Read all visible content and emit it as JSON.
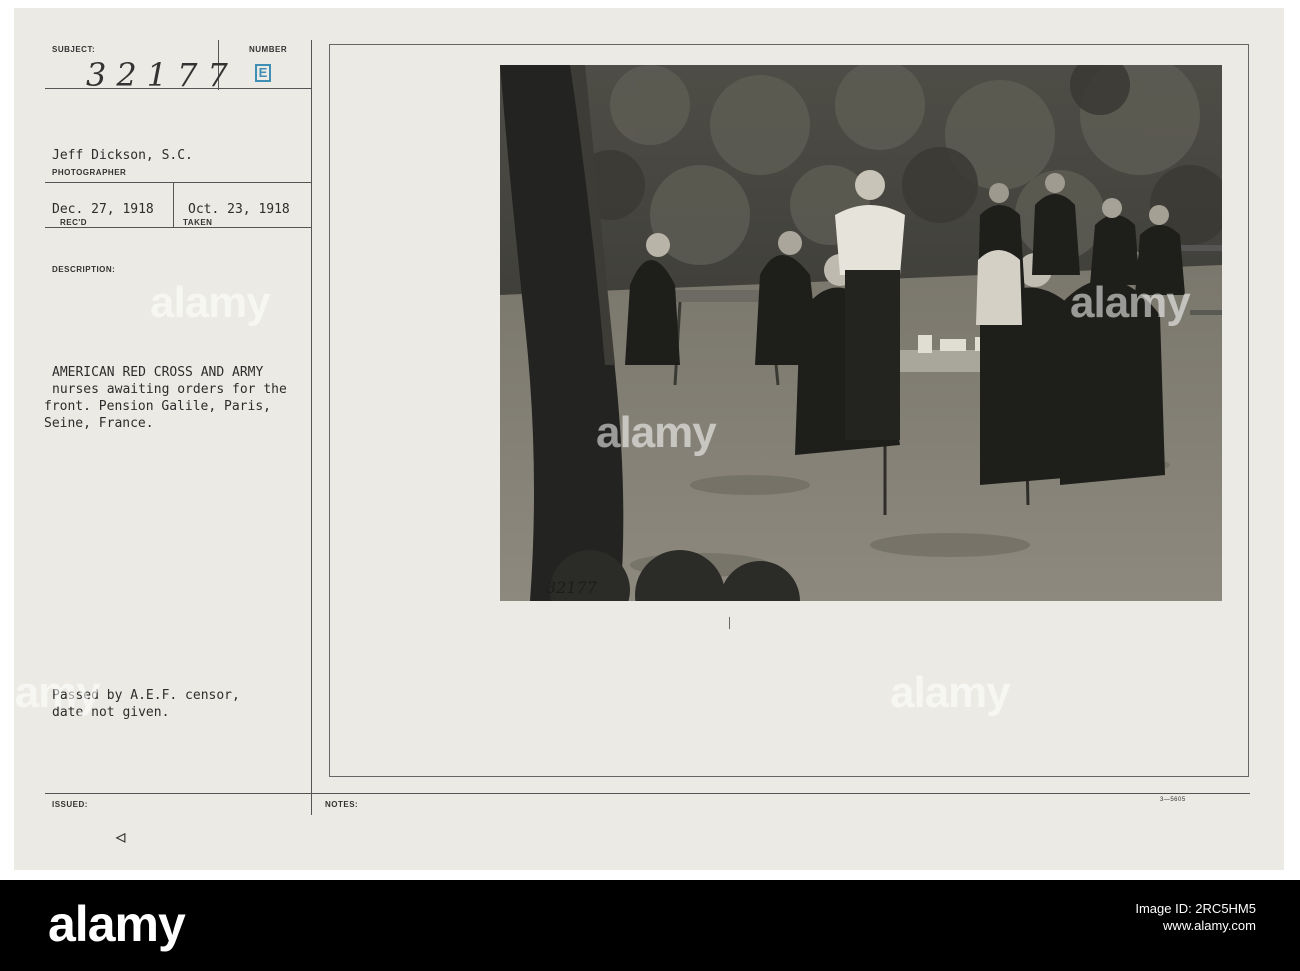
{
  "record": {
    "subject_label": "SUBJECT:",
    "subject_number": "32177",
    "number_label": "NUMBER",
    "number_stamp": "E",
    "photographer_name": "Jeff Dickson, S.C.",
    "photographer_label": "PHOTOGRAPHER",
    "received_date": "Dec. 27, 1918",
    "received_label": "REC'D",
    "taken_date": "Oct. 23, 1918",
    "taken_label": "TAKEN",
    "description_label": "DESCRIPTION:",
    "description_lines": [
      "AMERICAN RED CROSS AND ARMY",
      "nurses awaiting orders for the",
      "front. Pension Galile, Paris,",
      "Seine, France."
    ],
    "censor_lines": [
      "Passed by A.E.F. censor,",
      "date not given."
    ],
    "issued_label": "ISSUED:",
    "notes_label": "NOTES:",
    "form_number": "3—5605",
    "photo_number": "32177"
  },
  "watermarks": [
    "alamy",
    "alamy",
    "alamy",
    "alamy",
    "alamy"
  ],
  "footer": {
    "logo": "alamy",
    "image_id_label": "Image ID: 2RC5HM5",
    "url": "www.alamy.com",
    "image_id": "2RC5HM5"
  },
  "colors": {
    "card": "#eceae4",
    "stamp_blue": "#3f8fb5",
    "footer_bg": "#000000"
  }
}
